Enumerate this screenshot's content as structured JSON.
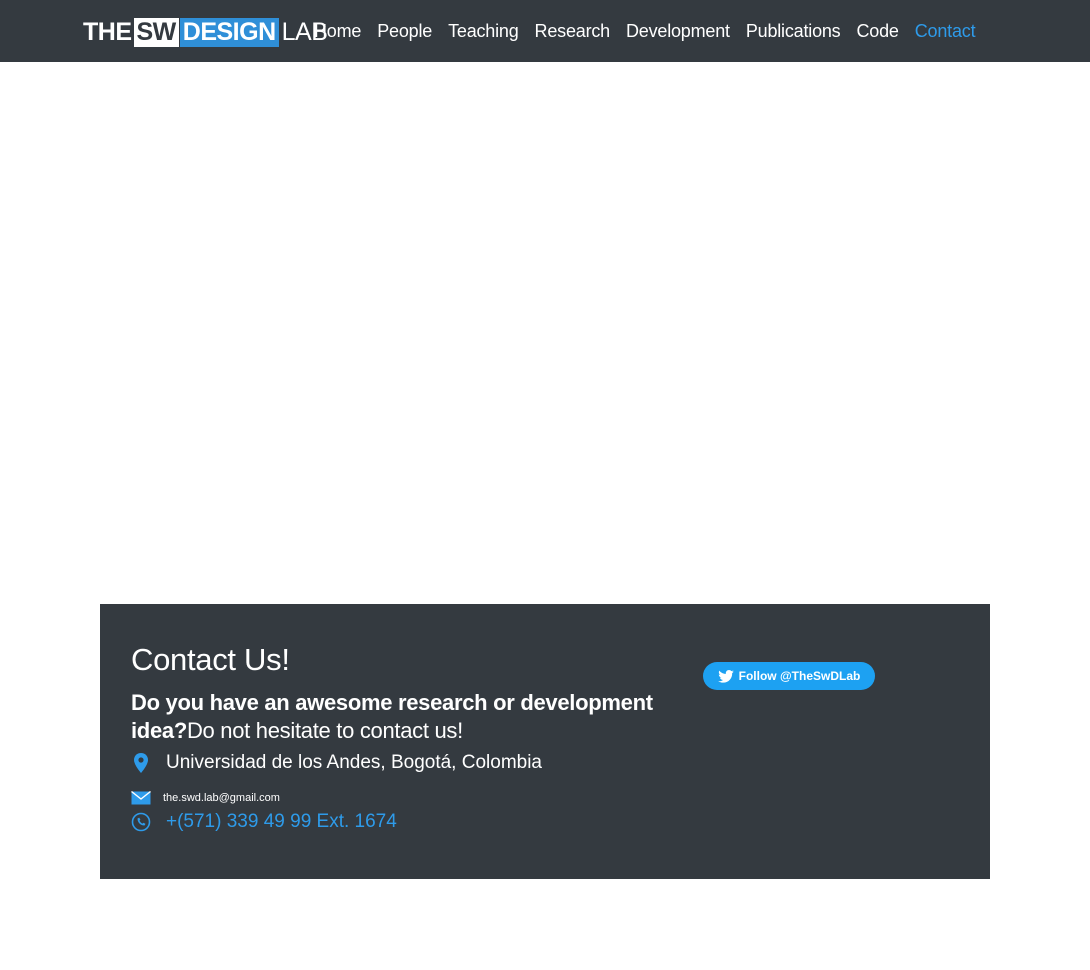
{
  "header": {
    "logo": {
      "the": "THE",
      "sw": "SW",
      "design": "DESIGN",
      "lab": "LAB"
    },
    "nav": [
      {
        "label": "Home"
      },
      {
        "label": "People"
      },
      {
        "label": "Teaching"
      },
      {
        "label": "Research"
      },
      {
        "label": "Development"
      },
      {
        "label": "Publications"
      },
      {
        "label": "Code"
      },
      {
        "label": "Contact",
        "active": true
      }
    ]
  },
  "contact": {
    "title": "Contact Us!",
    "lead_strong": "Do you have an awesome research or development idea?",
    "lead_rest": "Do not hesitate to contact us!",
    "address": "Universidad de los Andes, Bogotá, Colombia",
    "email": "the.swd.lab@gmail.com",
    "phone": "+(571) 339 49 99 Ext. 1674",
    "twitter_label": "Follow @TheSwDLab"
  },
  "icons": {
    "address": "map-pin-icon",
    "email": "envelope-icon",
    "phone": "phone-icon",
    "twitter": "twitter-bird-icon"
  },
  "colors": {
    "navbar_bg": "#343a40",
    "accent": "#2e9bea",
    "logo_design": "#2f8fd8",
    "twitter": "#1da1f2"
  }
}
